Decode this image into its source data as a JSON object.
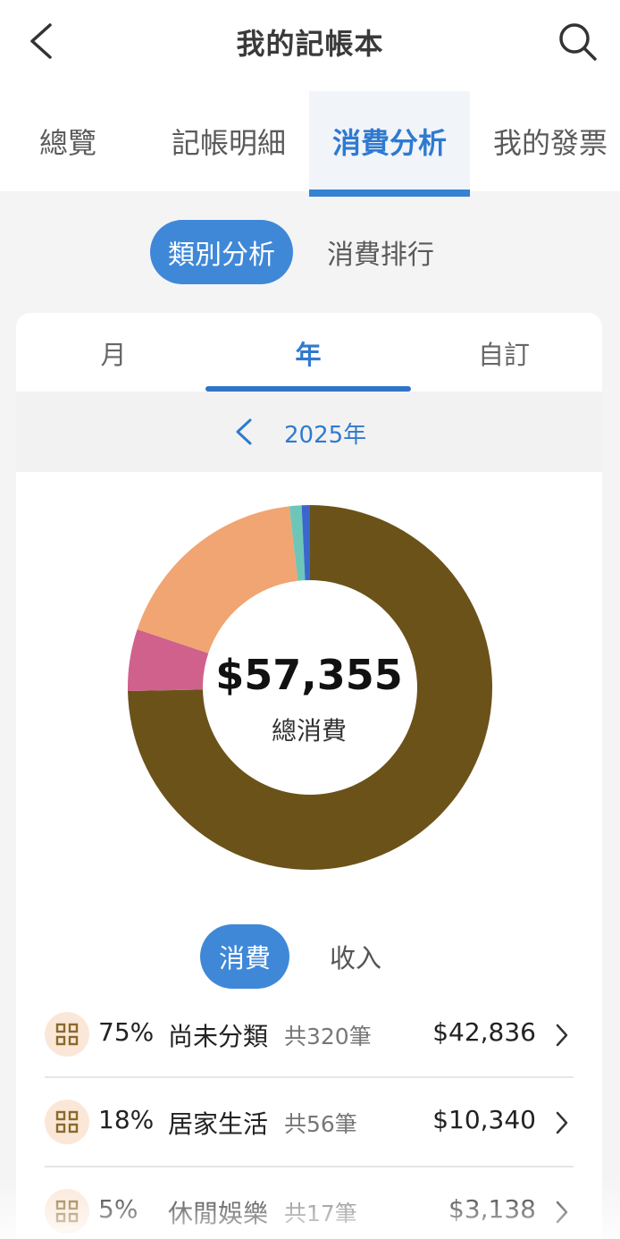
{
  "header": {
    "title": "我的記帳本",
    "back_icon": "chevron-left-icon",
    "search_icon": "search-icon"
  },
  "tabs": [
    {
      "label": "總覽",
      "active": false
    },
    {
      "label": "記帳明細",
      "active": false
    },
    {
      "label": "消費分析",
      "active": true
    },
    {
      "label": "我的發票",
      "active": false
    }
  ],
  "analysis_toggle": [
    {
      "label": "類別分析",
      "active": true
    },
    {
      "label": "消費排行",
      "active": false
    }
  ],
  "period_tabs": [
    {
      "label": "月",
      "active": false
    },
    {
      "label": "年",
      "active": true
    },
    {
      "label": "自訂",
      "active": false
    }
  ],
  "year_nav": {
    "label": "2025年",
    "prev_icon": "chevron-left-icon"
  },
  "summary": {
    "total": "$57,355",
    "label": "總消費"
  },
  "chart_data": {
    "type": "pie",
    "variant": "donut",
    "slices": [
      {
        "name": "尚未分類",
        "value": 42836,
        "color": "#6b5219"
      },
      {
        "name": "休閒娛樂",
        "value": 3138,
        "color": "#d0618c"
      },
      {
        "name": "居家生活",
        "value": 10340,
        "color": "#f0a572"
      },
      {
        "name": "",
        "value": 620,
        "color": "#6ec6b8"
      },
      {
        "name": "",
        "value": 421,
        "color": "#3b67cc"
      }
    ]
  },
  "type_toggle": [
    {
      "label": "消費",
      "active": true
    },
    {
      "label": "收入",
      "active": false
    }
  ],
  "categories": [
    {
      "percent": "75%",
      "name": "尚未分類",
      "count": "共320筆",
      "amount": "$42,836",
      "icon": "grid-icon"
    },
    {
      "percent": "18%",
      "name": "居家生活",
      "count": "共56筆",
      "amount": "$10,340",
      "icon": "grid-icon"
    },
    {
      "percent": "5%",
      "name": "休閒娛樂",
      "count": "共17筆",
      "amount": "$3,138",
      "icon": "grid-icon"
    }
  ],
  "colors": {
    "accent": "#3f88d8",
    "active_text": "#2f7ad0",
    "icon_bg": "#fbe7d8",
    "icon_fg": "#8a6a2a"
  }
}
